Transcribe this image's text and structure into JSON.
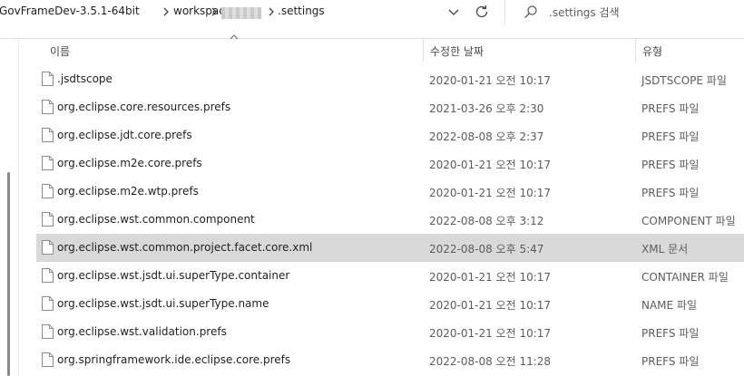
{
  "address_bar": {
    "crumbs": [
      "GovFrameDev-3.5.1-64bit",
      "workspace",
      ".settings"
    ],
    "refresh_icon": "refresh-icon",
    "dropdown_icon": "chevron-down-icon"
  },
  "search": {
    "placeholder": ".settings 검색",
    "icon": "search-icon"
  },
  "columns": {
    "name": "이름",
    "date": "수정한 날짜",
    "type": "유형"
  },
  "files": [
    {
      "name": ".jsdtscope",
      "date": "2020-01-21 오전 10:17",
      "type": "JSDTSCOPE 파일",
      "selected": false
    },
    {
      "name": "org.eclipse.core.resources.prefs",
      "date": "2021-03-26 오후 2:30",
      "type": "PREFS 파일",
      "selected": false
    },
    {
      "name": "org.eclipse.jdt.core.prefs",
      "date": "2022-08-08 오후 2:37",
      "type": "PREFS 파일",
      "selected": false
    },
    {
      "name": "org.eclipse.m2e.core.prefs",
      "date": "2020-01-21 오전 10:17",
      "type": "PREFS 파일",
      "selected": false
    },
    {
      "name": "org.eclipse.m2e.wtp.prefs",
      "date": "2020-01-21 오전 10:17",
      "type": "PREFS 파일",
      "selected": false
    },
    {
      "name": "org.eclipse.wst.common.component",
      "date": "2022-08-08 오후 3:12",
      "type": "COMPONENT 파일",
      "selected": false
    },
    {
      "name": "org.eclipse.wst.common.project.facet.core.xml",
      "date": "2022-08-08 오후 5:47",
      "type": "XML 문서",
      "selected": true
    },
    {
      "name": "org.eclipse.wst.jsdt.ui.superType.container",
      "date": "2020-01-21 오전 10:17",
      "type": "CONTAINER 파일",
      "selected": false
    },
    {
      "name": "org.eclipse.wst.jsdt.ui.superType.name",
      "date": "2020-01-21 오전 10:17",
      "type": "NAME 파일",
      "selected": false
    },
    {
      "name": "org.eclipse.wst.validation.prefs",
      "date": "2020-01-21 오전 10:17",
      "type": "PREFS 파일",
      "selected": false
    },
    {
      "name": "org.springframework.ide.eclipse.core.prefs",
      "date": "2022-08-08 오전 11:28",
      "type": "PREFS 파일",
      "selected": false
    }
  ],
  "colors": {
    "selected_row": "#d9d9d9",
    "text": "#1f1f1f",
    "secondary_text": "#5c5c5c"
  }
}
